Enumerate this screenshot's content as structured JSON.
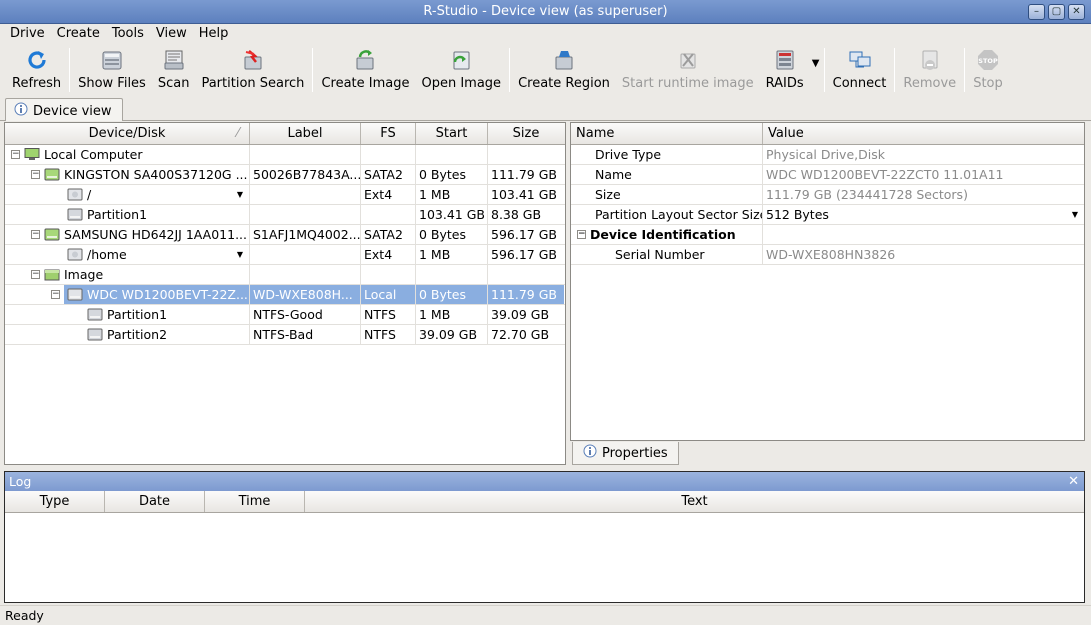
{
  "window": {
    "title": "R-Studio - Device view (as superuser)",
    "btn_minimize": "–",
    "btn_maximize": "▢",
    "btn_close": "✕"
  },
  "menu": [
    "Drive",
    "Create",
    "Tools",
    "View",
    "Help"
  ],
  "toolbar": {
    "refresh": "Refresh",
    "show_files": "Show Files",
    "scan": "Scan",
    "partition_search": "Partition Search",
    "create_image": "Create Image",
    "open_image": "Open Image",
    "create_region": "Create Region",
    "start_runtime_image": "Start runtime image",
    "raids": "RAIDs",
    "connect": "Connect",
    "remove": "Remove",
    "stop": "Stop",
    "stop_icon_text": "STOP"
  },
  "tabs": {
    "device_view": "Device view",
    "properties": "Properties"
  },
  "device_table": {
    "headers": [
      "Device/Disk",
      "Label",
      "FS",
      "Start",
      "Size"
    ],
    "sort_indicator": "⁄",
    "rows": [
      {
        "name": "Local Computer",
        "label": "",
        "fs": "",
        "start": "",
        "size": ""
      },
      {
        "name": "KINGSTON SA400S37120G ...",
        "label": "50026B77843A...",
        "fs": "SATA2",
        "start": "0 Bytes",
        "size": "111.79 GB"
      },
      {
        "name": "/",
        "label": "",
        "fs": "Ext4",
        "start": "1 MB",
        "size": "103.41 GB"
      },
      {
        "name": "Partition1",
        "label": "",
        "fs": "",
        "start": "103.41 GB",
        "size": "8.38 GB"
      },
      {
        "name": "SAMSUNG HD642JJ 1AA011...",
        "label": "S1AFJ1MQ4002...",
        "fs": "SATA2",
        "start": "0 Bytes",
        "size": "596.17 GB"
      },
      {
        "name": "/home",
        "label": "",
        "fs": "Ext4",
        "start": "1 MB",
        "size": "596.17 GB"
      },
      {
        "name": "Image",
        "label": "",
        "fs": "",
        "start": "",
        "size": ""
      },
      {
        "name": "WDC WD1200BEVT-22Z...",
        "label": "WD-WXE808H...",
        "fs": "Local",
        "start": "0 Bytes",
        "size": "111.79 GB"
      },
      {
        "name": "Partition1",
        "label": "NTFS-Good",
        "fs": "NTFS",
        "start": "1 MB",
        "size": "39.09 GB"
      },
      {
        "name": "Partition2",
        "label": "NTFS-Bad",
        "fs": "NTFS",
        "start": "39.09 GB",
        "size": "72.70 GB"
      }
    ]
  },
  "properties_table": {
    "headers": [
      "Name",
      "Value"
    ],
    "rows": [
      {
        "name": "Drive Type",
        "value": "Physical Drive,Disk"
      },
      {
        "name": "Name",
        "value": "WDC WD1200BEVT-22ZCT0 11.01A11"
      },
      {
        "name": "Size",
        "value": "111.79 GB (234441728 Sectors)"
      },
      {
        "name": "Partition Layout Sector Size",
        "value": "512 Bytes"
      },
      {
        "name": "Device Identification",
        "value": ""
      },
      {
        "name": "Serial Number",
        "value": "WD-WXE808HN3826"
      }
    ]
  },
  "log": {
    "title": "Log",
    "close": "✕",
    "headers": [
      "Type",
      "Date",
      "Time",
      "Text"
    ]
  },
  "status": "Ready",
  "colors": {
    "selection": "#8aaee0",
    "titlebar": "#6b8cc7"
  }
}
